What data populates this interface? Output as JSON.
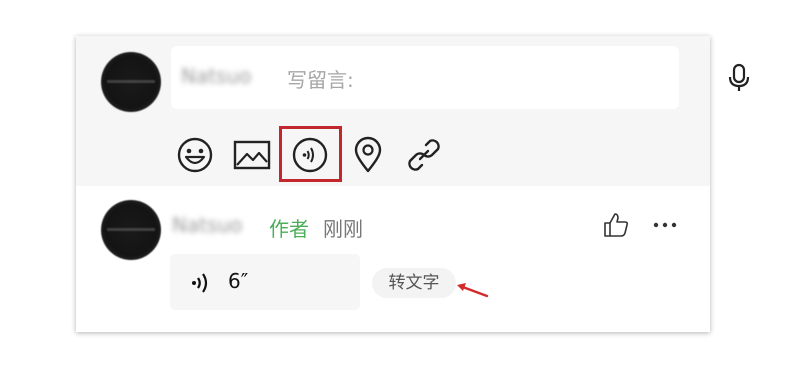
{
  "compose": {
    "user_name_blurred": "Natsuo",
    "placeholder": "写留言:",
    "toolbar": [
      "emoji-icon",
      "image-icon",
      "voice-icon",
      "location-icon",
      "link-icon"
    ]
  },
  "comment": {
    "user_name_blurred": "Natsuo",
    "author_tag": "作者",
    "time": "刚刚",
    "voice_duration": "6″",
    "convert_label": "转文字"
  },
  "colors": {
    "author_green": "#4cae58",
    "highlight_red": "#c1272d",
    "arrow_red": "#d42a2a"
  }
}
